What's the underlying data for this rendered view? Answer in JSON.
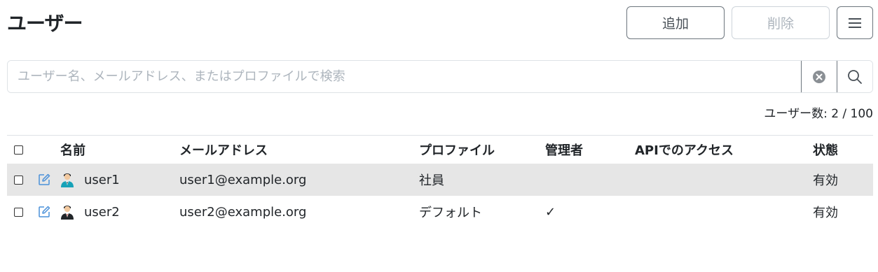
{
  "header": {
    "title": "ユーザー",
    "add_label": "追加",
    "delete_label": "削除"
  },
  "search": {
    "placeholder": "ユーザー名、メールアドレス、またはプロファイルで検索",
    "value": ""
  },
  "user_count": "ユーザー数: 2 / 100",
  "table": {
    "columns": {
      "name": "名前",
      "email": "メールアドレス",
      "profile": "プロファイル",
      "admin": "管理者",
      "api": "APIでのアクセス",
      "status": "状態"
    },
    "rows": [
      {
        "name": "user1",
        "email": "user1@example.org",
        "profile": "社員",
        "admin": "",
        "api": "",
        "status": "有効",
        "avatar_tie": "#17a2b8"
      },
      {
        "name": "user2",
        "email": "user2@example.org",
        "profile": "デフォルト",
        "admin": "✓",
        "api": "",
        "status": "有効",
        "avatar_tie": "#212529"
      }
    ]
  },
  "colors": {
    "selected_row": "#e6e6e6",
    "edit_icon": "#4a90d9"
  },
  "icons": [
    "menu-icon",
    "clear-icon",
    "search-icon",
    "edit-icon",
    "user-avatar-icon"
  ]
}
